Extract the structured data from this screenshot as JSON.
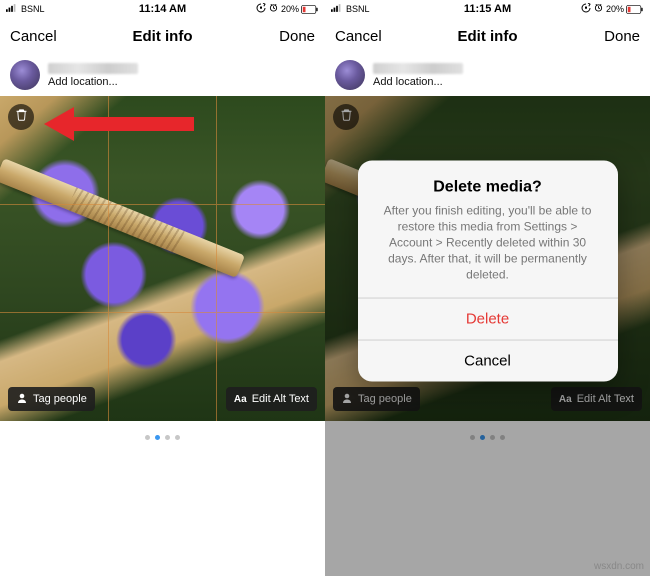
{
  "statusbar": {
    "carrier": "BSNL",
    "time_left": "11:14 AM",
    "time_right": "11:15 AM",
    "battery_text": "20%"
  },
  "nav": {
    "cancel": "Cancel",
    "title": "Edit info",
    "done": "Done"
  },
  "post": {
    "add_location": "Add location..."
  },
  "overlay": {
    "tag_people": "Tag people",
    "alt_text": "Edit Alt Text",
    "aa": "Aa"
  },
  "carousel": {
    "dots": 4,
    "active": 1
  },
  "dialog": {
    "title": "Delete media?",
    "message": "After you finish editing, you'll be able to restore this media from Settings > Account > Recently deleted within 30 days. After that, it will be permanently deleted.",
    "delete": "Delete",
    "cancel": "Cancel"
  },
  "watermark": "wsxdn.com"
}
